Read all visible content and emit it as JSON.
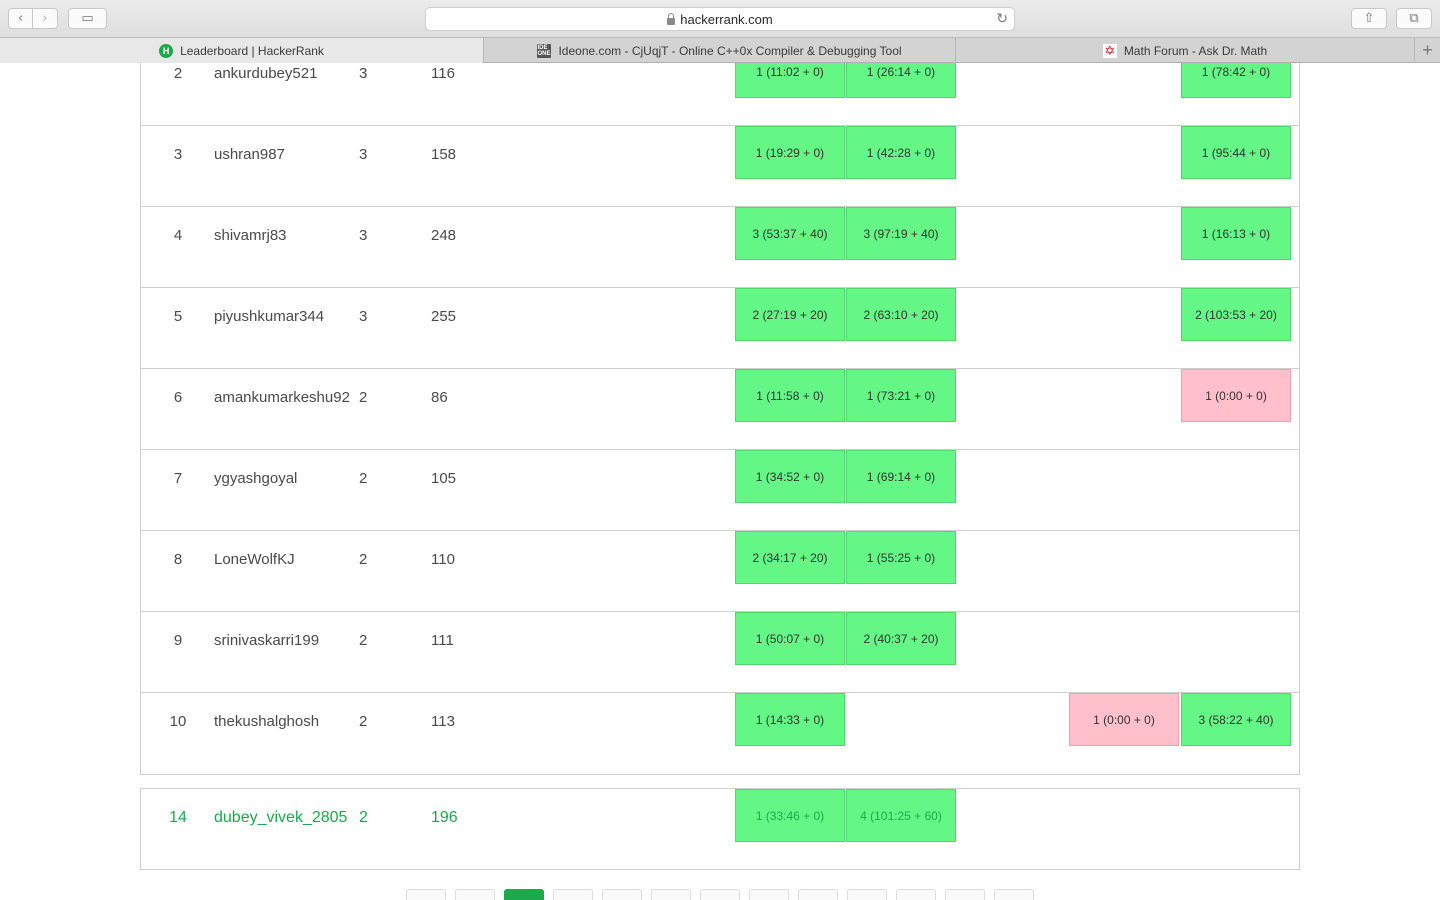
{
  "browser": {
    "url": "hackerrank.com",
    "tabs": [
      {
        "title": "Leaderboard | HackerRank",
        "active": true,
        "icon": "hackerrank-icon"
      },
      {
        "title": "Ideone.com - CjUqjT - Online C++0x Compiler & Debugging Tool",
        "active": false,
        "icon": "ideone-icon"
      },
      {
        "title": "Math Forum - Ask Dr. Math",
        "active": false,
        "icon": "math-forum-icon"
      }
    ],
    "icons": {
      "back": "‹",
      "forward": "›",
      "sidebar": "▭",
      "reload": "↻",
      "share": "⇧",
      "tabs": "⧉",
      "new_tab": "+"
    },
    "favicon_text": {
      "hackerrank": "H",
      "ideone": "IDE ONE",
      "math": "✡"
    }
  },
  "colors": {
    "accepted": "#64f785",
    "wrong": "#ffc0cb",
    "brand": "#1ba94c"
  },
  "leaderboard": {
    "rows": [
      {
        "rank": "2",
        "name": "ankurdubey521",
        "solved": "3",
        "score": "116",
        "cells": [
          {
            "col": 1,
            "text": "1 (11:02 + 0)",
            "status": "ok"
          },
          {
            "col": 2,
            "text": "1 (26:14 + 0)",
            "status": "ok"
          },
          {
            "col": 5,
            "text": "1 (78:42 + 0)",
            "status": "ok"
          }
        ]
      },
      {
        "rank": "3",
        "name": "ushran987",
        "solved": "3",
        "score": "158",
        "cells": [
          {
            "col": 1,
            "text": "1 (19:29 + 0)",
            "status": "ok"
          },
          {
            "col": 2,
            "text": "1 (42:28 + 0)",
            "status": "ok"
          },
          {
            "col": 5,
            "text": "1 (95:44 + 0)",
            "status": "ok"
          }
        ]
      },
      {
        "rank": "4",
        "name": "shivamrj83",
        "solved": "3",
        "score": "248",
        "cells": [
          {
            "col": 1,
            "text": "3 (53:37 + 40)",
            "status": "ok"
          },
          {
            "col": 2,
            "text": "3 (97:19 + 40)",
            "status": "ok"
          },
          {
            "col": 5,
            "text": "1 (16:13 + 0)",
            "status": "ok"
          }
        ]
      },
      {
        "rank": "5",
        "name": "piyushkumar344",
        "solved": "3",
        "score": "255",
        "cells": [
          {
            "col": 1,
            "text": "2 (27:19 + 20)",
            "status": "ok"
          },
          {
            "col": 2,
            "text": "2 (63:10 + 20)",
            "status": "ok"
          },
          {
            "col": 5,
            "text": "2 (103:53 + 20)",
            "status": "ok"
          }
        ]
      },
      {
        "rank": "6",
        "name": "amankumarkeshu92",
        "solved": "2",
        "score": "86",
        "cells": [
          {
            "col": 1,
            "text": "1 (11:58 + 0)",
            "status": "ok"
          },
          {
            "col": 2,
            "text": "1 (73:21 + 0)",
            "status": "ok"
          },
          {
            "col": 5,
            "text": "1 (0:00 + 0)",
            "status": "fail"
          }
        ]
      },
      {
        "rank": "7",
        "name": "ygyashgoyal",
        "solved": "2",
        "score": "105",
        "cells": [
          {
            "col": 1,
            "text": "1 (34:52 + 0)",
            "status": "ok"
          },
          {
            "col": 2,
            "text": "1 (69:14 + 0)",
            "status": "ok"
          }
        ]
      },
      {
        "rank": "8",
        "name": "LoneWolfKJ",
        "solved": "2",
        "score": "110",
        "cells": [
          {
            "col": 1,
            "text": "2 (34:17 + 20)",
            "status": "ok"
          },
          {
            "col": 2,
            "text": "1 (55:25 + 0)",
            "status": "ok"
          }
        ]
      },
      {
        "rank": "9",
        "name": "srinivaskarri199",
        "solved": "2",
        "score": "111",
        "cells": [
          {
            "col": 1,
            "text": "1 (50:07 + 0)",
            "status": "ok"
          },
          {
            "col": 2,
            "text": "2 (40:37 + 20)",
            "status": "ok"
          }
        ]
      },
      {
        "rank": "10",
        "name": "thekushalghosh",
        "solved": "2",
        "score": "113",
        "cells": [
          {
            "col": 1,
            "text": "1 (14:33 + 0)",
            "status": "ok"
          },
          {
            "col": 4,
            "text": "1 (0:00 + 0)",
            "status": "fail"
          },
          {
            "col": 5,
            "text": "3 (58:22 + 40)",
            "status": "ok"
          }
        ]
      }
    ],
    "current_user": {
      "rank": "14",
      "name": "dubey_vivek_2805",
      "solved": "2",
      "score": "196",
      "cells": [
        {
          "col": 1,
          "text": "1 (33:46 + 0)",
          "status": "ok"
        },
        {
          "col": 2,
          "text": "4 (101:25 + 60)",
          "status": "ok"
        }
      ]
    }
  },
  "pagination": {
    "count": 13,
    "active_index": 2
  }
}
